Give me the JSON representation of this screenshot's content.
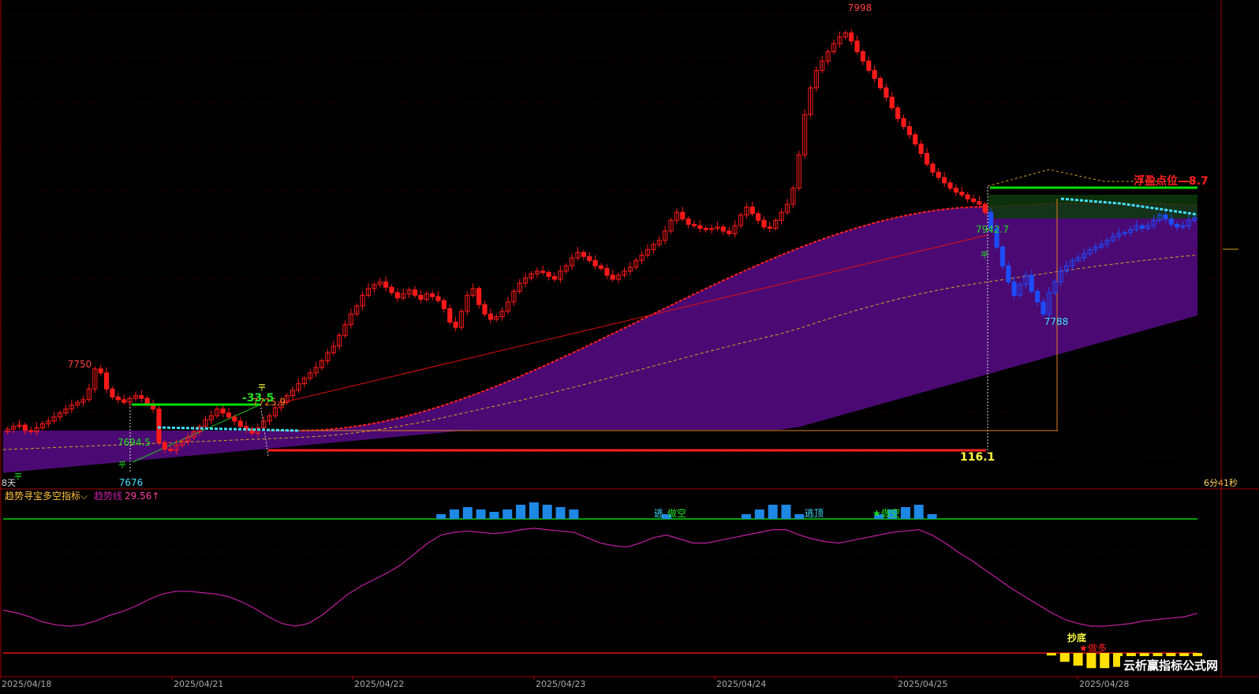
{
  "colors": {
    "background": "#000000",
    "up_candle": "#ff1a1a",
    "down_candle_main": "#ff1a1a",
    "right_section_candle": "#1d4cff",
    "band_fill": "#4b0a73",
    "band_edge": "#ff2020",
    "trend_line": "#c020a0",
    "zero_line": "#00d000",
    "bottom_line": "#e01010",
    "hist_top": "#1e88e5",
    "hist_bottom": "#ffe000",
    "grid": "#5a0000"
  },
  "main_panel": {
    "high_label": "7998",
    "left_peak_label": "7750",
    "low_label_left": "7676",
    "low_label_right": "7788",
    "price_label_1": "7694.5",
    "price_label_2": "7942.7",
    "price_label_3": "7725.9",
    "pnl_label": "-33.5",
    "float_label": "浮盈点位—8.7",
    "gain_label": "116.1",
    "ping_marker": "平",
    "left_corner_text": "8天",
    "right_corner_text": "6分41秒"
  },
  "indicator_panel": {
    "menu_title": "趋势寻宝多空指标",
    "trend_label": "趋势线",
    "trend_value": "29.56↑",
    "signal_escape_1": "逃",
    "signal_short_1": "做空",
    "signal_escape_2": "逃顶",
    "signal_short_2": "做空",
    "signal_bottom": "抄底",
    "signal_long": "做多",
    "watermark": "云析赢指标公式网"
  },
  "axis": {
    "date_labels": [
      "2025/04/18",
      "2025/04/21",
      "2025/04/22",
      "2025/04/23",
      "2025/04/24",
      "2025/04/25",
      "2025/04/28"
    ]
  },
  "chart_data": [
    {
      "type": "candlestick",
      "title": "",
      "ylim": [
        7660,
        8010
      ],
      "labels": [
        "7750",
        "7998",
        "7676",
        "7788",
        "7694.5",
        "7942.7",
        "7725.9"
      ],
      "close": [
        7700,
        7702,
        7703,
        7699,
        7698,
        7701,
        7704,
        7706,
        7709,
        7712,
        7715,
        7718,
        7720,
        7722,
        7730,
        7745,
        7742,
        7730,
        7724,
        7722,
        7720,
        7723,
        7725,
        7723,
        7719,
        7715,
        7690,
        7685,
        7684,
        7688,
        7691,
        7694,
        7698,
        7702,
        7707,
        7710,
        7715,
        7712,
        7709,
        7706,
        7702,
        7700,
        7697,
        7701,
        7706,
        7710,
        7716,
        7720,
        7725,
        7729,
        7734,
        7738,
        7742,
        7746,
        7751,
        7757,
        7762,
        7770,
        7778,
        7786,
        7792,
        7800,
        7805,
        7808,
        7810,
        7806,
        7802,
        7798,
        7801,
        7804,
        7800,
        7797,
        7801,
        7799,
        7796,
        7790,
        7780,
        7776,
        7788,
        7800,
        7805,
        7793,
        7786,
        7782,
        7784,
        7788,
        7795,
        7803,
        7809,
        7813,
        7816,
        7818,
        7817,
        7814,
        7812,
        7818,
        7822,
        7828,
        7832,
        7829,
        7826,
        7822,
        7820,
        7815,
        7812,
        7815,
        7818,
        7821,
        7826,
        7830,
        7834,
        7838,
        7841,
        7848,
        7856,
        7862,
        7857,
        7853,
        7852,
        7850,
        7849,
        7850,
        7851,
        7848,
        7846,
        7852,
        7860,
        7866,
        7861,
        7856,
        7851,
        7850,
        7856,
        7862,
        7868,
        7880,
        7905,
        7935,
        7955,
        7968,
        7975,
        7982,
        7988,
        7993,
        7996,
        7990,
        7982,
        7975,
        7968,
        7962,
        7955,
        7948,
        7940,
        7932,
        7926,
        7920,
        7913,
        7906,
        7898,
        7892,
        7888,
        7884,
        7880,
        7877,
        7875,
        7872,
        7870,
        7868,
        7862,
        7850,
        7836,
        7822,
        7810,
        7800,
        7808,
        7815,
        7803,
        7795,
        7786,
        7802,
        7810,
        7818,
        7822,
        7826,
        7828,
        7831,
        7834,
        7836,
        7838,
        7841,
        7844,
        7846,
        7847,
        7849,
        7852,
        7850,
        7852,
        7856,
        7860,
        7857,
        7853,
        7851,
        7852,
        7856,
        7858
      ]
    },
    {
      "type": "line",
      "title": "",
      "ylim": [
        0,
        100
      ],
      "series": [
        {
          "name": "趋势线",
          "values": [
            32,
            30,
            27,
            23,
            21,
            20,
            21,
            24,
            28,
            31,
            35,
            40,
            44,
            46,
            46,
            45,
            44,
            42,
            38,
            33,
            27,
            22,
            20,
            22,
            28,
            36,
            44,
            50,
            55,
            60,
            66,
            74,
            82,
            88,
            90,
            91,
            90,
            89,
            90,
            92,
            93,
            92,
            91,
            90,
            86,
            82,
            80,
            79,
            82,
            86,
            88,
            85,
            82,
            82,
            84,
            86,
            88,
            90,
            92,
            92,
            88,
            85,
            83,
            82,
            84,
            86,
            88,
            90,
            91,
            92,
            88,
            82,
            75,
            69,
            62,
            55,
            48,
            42,
            36,
            30,
            25,
            22,
            20,
            20,
            21,
            22,
            24,
            25,
            26,
            27,
            29.56
          ]
        }
      ]
    }
  ]
}
